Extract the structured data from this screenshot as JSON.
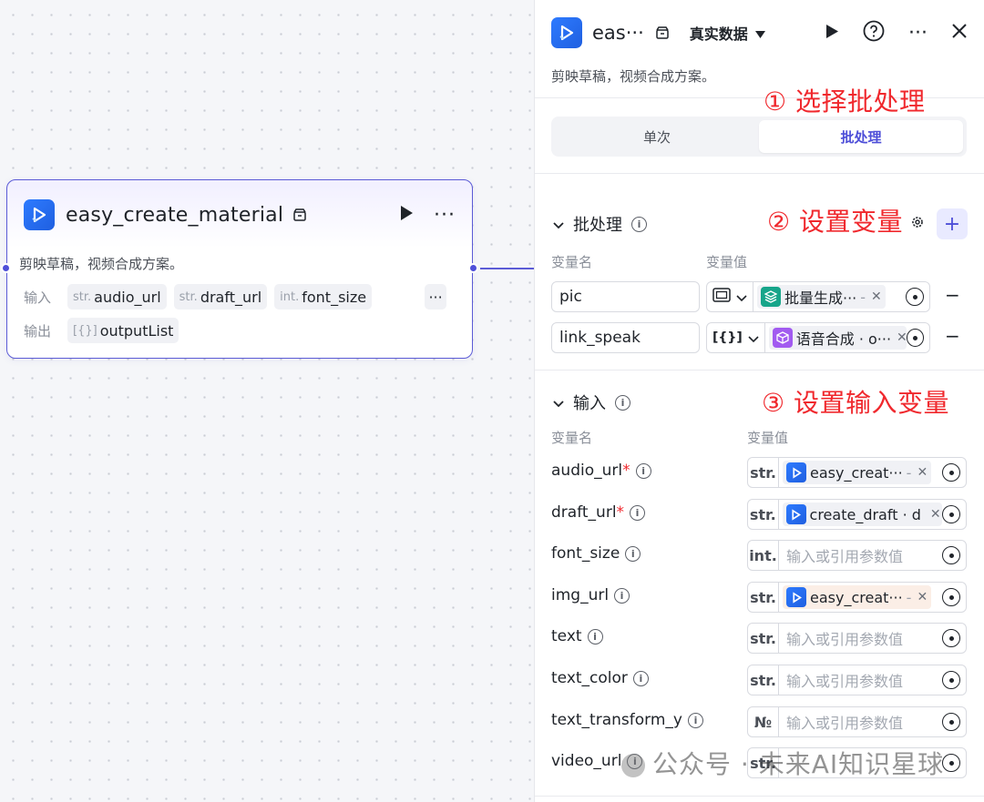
{
  "node": {
    "title": "easy_create_material",
    "description": "剪映草稿，视频合成方案。",
    "input_label": "输入",
    "output_label": "输出",
    "inputs": [
      {
        "type": "str.",
        "name": "audio_url"
      },
      {
        "type": "str.",
        "name": "draft_url"
      },
      {
        "type": "int.",
        "name": "font_size"
      }
    ],
    "more": "···",
    "outputs": [
      {
        "type": "[{}]",
        "name": "outputList"
      }
    ]
  },
  "panel": {
    "title": "eas···",
    "data_mode": "真实数据",
    "description": "剪映草稿，视频合成方案。",
    "tabs": [
      {
        "label": "单次",
        "active": false
      },
      {
        "label": "批处理",
        "active": true
      }
    ],
    "batch": {
      "title": "批处理",
      "col_name": "变量名",
      "col_value": "变量值",
      "add": "+",
      "rows": [
        {
          "name": "pic",
          "type_icon": "image-icon",
          "ref": "批量生成···",
          "ref_suffix": "-",
          "ref_color": "#17a58a"
        },
        {
          "name": "link_speak",
          "type_icon": "array-object-icon",
          "ref": "语音合成 · o···",
          "ref_suffix": "",
          "ref_color": "#a25bf0"
        }
      ]
    },
    "inputs": {
      "title": "输入",
      "col_name": "变量名",
      "col_value": "变量值",
      "rows": [
        {
          "name": "audio_url",
          "required": "*",
          "type": "str.",
          "ref": "easy_creat···",
          "ref_suffix": "-",
          "placeholder": ""
        },
        {
          "name": "draft_url",
          "required": "*",
          "type": "str.",
          "ref": "create_draft · d",
          "ref_suffix": "",
          "placeholder": ""
        },
        {
          "name": "font_size",
          "required": "",
          "type": "int.",
          "ref": "",
          "ref_suffix": "",
          "placeholder": "输入或引用参数值"
        },
        {
          "name": "img_url",
          "required": "",
          "type": "str.",
          "ref": "easy_creat···",
          "ref_suffix": "-",
          "placeholder": ""
        },
        {
          "name": "text",
          "required": "",
          "type": "str.",
          "ref": "",
          "ref_suffix": "",
          "placeholder": "输入或引用参数值"
        },
        {
          "name": "text_color",
          "required": "",
          "type": "str.",
          "ref": "",
          "ref_suffix": "",
          "placeholder": "输入或引用参数值"
        },
        {
          "name": "text_transform_y",
          "required": "",
          "type": "№",
          "ref": "",
          "ref_suffix": "",
          "placeholder": "输入或引用参数值"
        },
        {
          "name": "video_url",
          "required": "",
          "type": "str.",
          "ref": "",
          "ref_suffix": "",
          "placeholder": ""
        }
      ]
    }
  },
  "annotations": {
    "step1": "① 选择批处理",
    "step2": "② 设置变量",
    "step3": "③ 设置输入变量"
  },
  "watermark": "公众号 · 未来AI知识星球",
  "colors": {
    "accent": "#4e4fd8",
    "annotation": "#f0282d",
    "app_icon": "#2e7bff"
  }
}
